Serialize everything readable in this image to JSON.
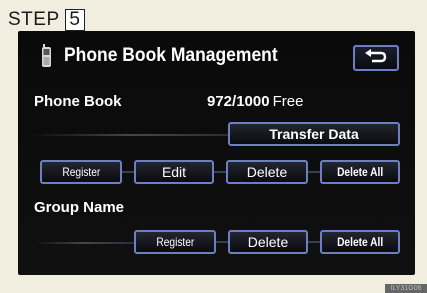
{
  "step": {
    "label": "STEP",
    "number": "5"
  },
  "header": {
    "title": "Phone Book Management"
  },
  "phone_book": {
    "label": "Phone Book",
    "count": "972/1000",
    "suffix": "Free"
  },
  "buttons": {
    "transfer_data": "Transfer Data",
    "register": "Register",
    "edit": "Edit",
    "delete": "Delete",
    "delete_all": "Delete All"
  },
  "group": {
    "label": "Group Name",
    "register": "Register",
    "delete": "Delete",
    "delete_all": "Delete All"
  },
  "icons": {
    "back": "back-arrow-icon",
    "phone": "mobile-phone-icon"
  },
  "colors": {
    "screen": "#0a0a0a",
    "button_border": "#6c7fc2",
    "page": "#f1eee0"
  },
  "watermark": "ILY31G06"
}
